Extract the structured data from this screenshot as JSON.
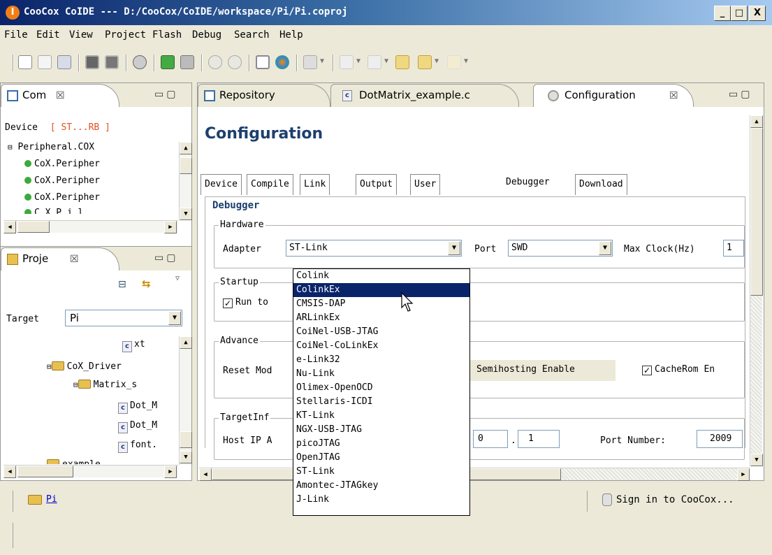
{
  "window": {
    "title": "CooCox CoIDE --- D:/CooCox/CoIDE/workspace/Pi/Pi.coproj",
    "app_icon": "I",
    "min": "_",
    "max": "□",
    "close": "X"
  },
  "menu": [
    "File",
    "Edit",
    "View",
    "Project",
    "Flash",
    "Debug",
    "Search",
    "Help"
  ],
  "components_view": {
    "tab_label": "Com",
    "device_label": "Device",
    "device_value": "[ ST...RB ]",
    "root": "Peripheral.COX",
    "items": [
      "CoX.Peripher",
      "CoX.Peripher",
      "CoX.Peripher",
      "C X P i l"
    ]
  },
  "project_view": {
    "tab_label": "Proje",
    "target_label": "Target",
    "target_value": "Pi",
    "items": [
      "xt",
      "CoX_Driver",
      "Matrix_s",
      "Dot_M",
      "Dot_M",
      "font.",
      "example"
    ]
  },
  "editor_tabs": [
    "Repository",
    "DotMatrix_example.c",
    "Configuration"
  ],
  "config": {
    "heading": "Configuration",
    "tabs": [
      "Device",
      "Compile",
      "Link",
      "Output",
      "User",
      "Debugger",
      "Download"
    ],
    "active_tab": "Debugger",
    "section_title": "Debugger",
    "hardware": {
      "group": "Hardware",
      "adapter_label": "Adapter",
      "adapter_value": "ST-Link",
      "port_label": "Port",
      "port_value": "SWD",
      "max_clock_label": "Max Clock(Hz)",
      "max_clock_value": "1"
    },
    "startup": {
      "group": "Startup",
      "run_to": "Run to",
      "run_to_checked": true
    },
    "advance": {
      "group": "Advance",
      "reset_mode": "Reset Mod",
      "semihosting": "Semihosting Enable",
      "cacherom": "CacheRom En",
      "cacherom_checked": true
    },
    "target_info": {
      "group": "TargetInf",
      "host_ip": "Host IP A",
      "ip_octet3": "0",
      "ip_octet4": "1",
      "port_number_label": "Port Number:",
      "port_number": "2009"
    }
  },
  "adapter_options": [
    "Colink",
    "ColinkEx",
    "CMSIS-DAP",
    "ARLinkEx",
    "CoiNel-USB-JTAG",
    "CoiNel-CoLinkEx",
    "e-Link32",
    "Nu-Link",
    "Olimex-OpenOCD",
    "Stellaris-ICDI",
    "KT-Link",
    "NGX-USB-JTAG",
    "picoJTAG",
    "OpenJTAG",
    "ST-Link",
    "Amontec-JTAGkey",
    "J-Link"
  ],
  "highlighted_option": "ColinkEx",
  "status_bar": {
    "project": "Pi",
    "sign_in": "Sign in to CooCox..."
  },
  "icons": {
    "accent": "#0a246a",
    "folder": "folder-icon",
    "cfile": "c-file-icon",
    "lock": "lock-icon"
  }
}
